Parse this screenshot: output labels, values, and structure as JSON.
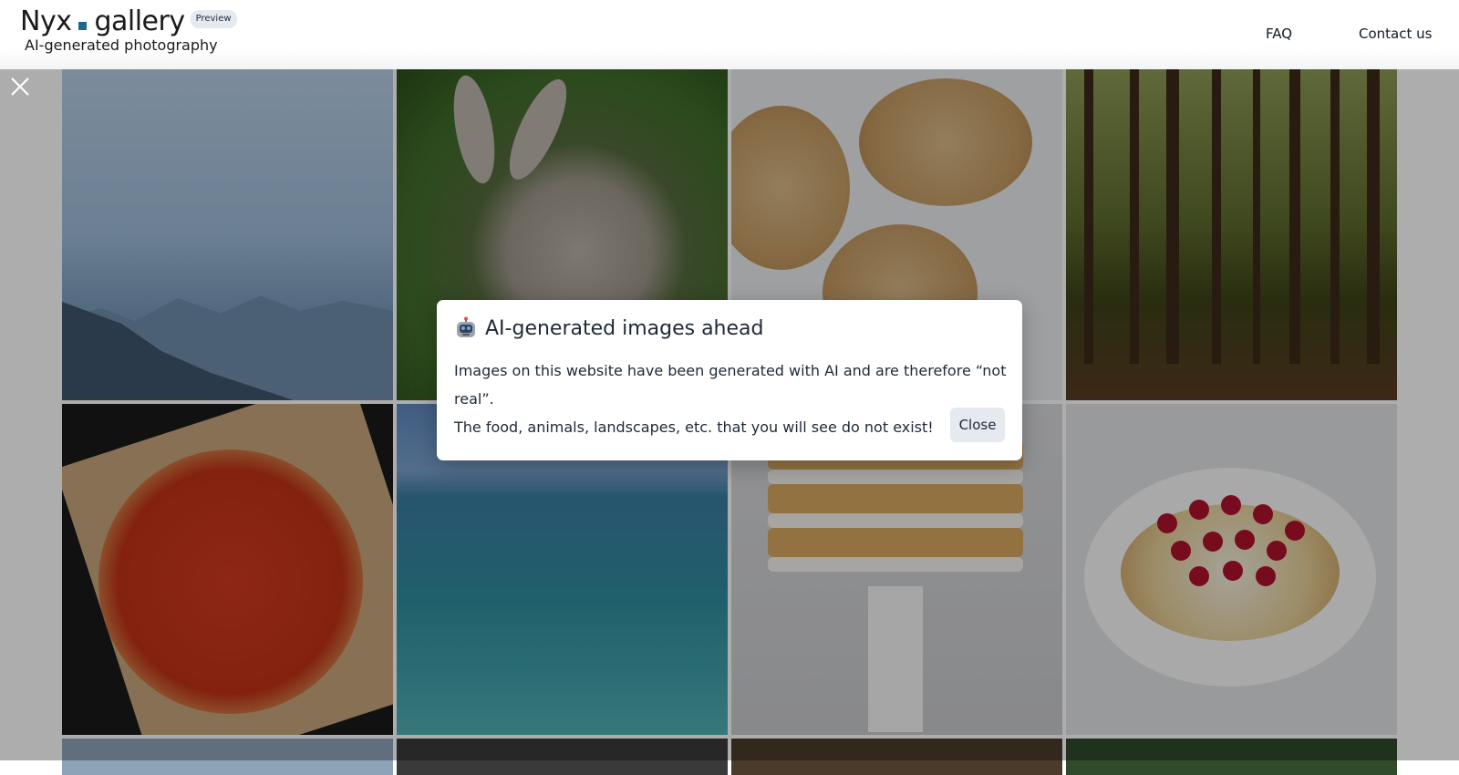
{
  "header": {
    "logo_left": "Nyx",
    "logo_right": "gallery",
    "badge": "Preview",
    "tagline": "AI-generated photography",
    "nav": [
      "FAQ",
      "Contact us"
    ],
    "accent_color": "#1d6a8a"
  },
  "modal": {
    "title": "AI-generated images ahead",
    "title_icon": "robot-icon",
    "body_line1": "Images on this website have been generated with AI and are therefore “not real”.",
    "body_line2": "The food, animals, landscapes, etc. that you will see do not exist!",
    "close_label": "Close"
  },
  "gallery": {
    "tiles": [
      "mountains",
      "rabbit",
      "cookies",
      "forest",
      "pizza",
      "sea",
      "strawberry cake",
      "raspberry tart"
    ],
    "overlay_color": "#000000"
  }
}
